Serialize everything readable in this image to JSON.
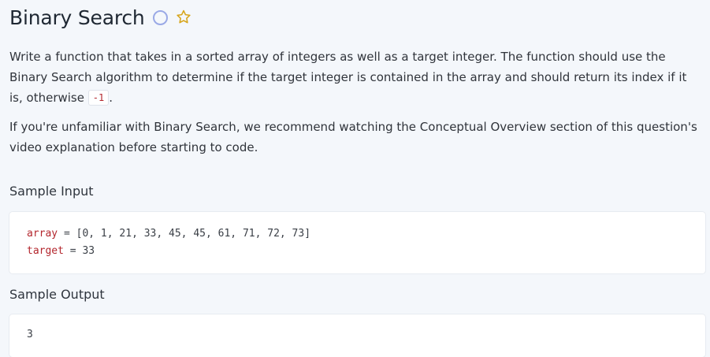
{
  "problem": {
    "title": "Binary Search",
    "icons": {
      "status": "circle-outline-icon",
      "favorite": "star-outline-icon"
    },
    "description": {
      "paragraph_1": "Write a function that takes in a sorted array of integers as well as a target integer. The function should use the Binary Search algorithm to determine if the target integer is contained in the array and should return its index if it is, otherwise ",
      "paragraph_1_code": "-1",
      "paragraph_1_tail": ".",
      "paragraph_2": "If you're unfamiliar with Binary Search, we recommend watching the Conceptual Overview section of this question's video explanation before starting to code."
    }
  },
  "sample_input": {
    "label": "Sample Input",
    "lines": [
      {
        "name": "array",
        "operator": " = ",
        "value": "[0, 1, 21, 33, 45, 45, 61, 71, 72, 73]"
      },
      {
        "name": "target",
        "operator": " = ",
        "value": "33"
      }
    ]
  },
  "sample_output": {
    "label": "Sample Output",
    "value": "3"
  },
  "colors": {
    "background": "#f4f7fb",
    "panel": "#ffffff",
    "accent_code": "#b3262d",
    "icon_blue": "#9aa9e6",
    "icon_gold": "#d7a51a"
  }
}
